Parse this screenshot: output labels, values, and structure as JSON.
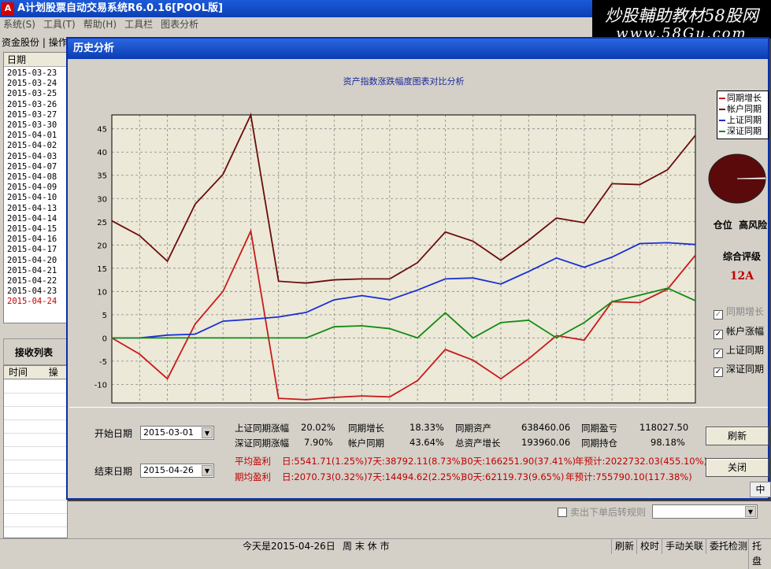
{
  "app": {
    "title": "A计划股票自动交易系统R6.0.16[POOL版]",
    "icon": "A"
  },
  "watermark": {
    "line1": "炒股輔助教材58股网",
    "line2": "www.58Gu.com"
  },
  "menu": [
    "系统(S)",
    "工具(T)",
    "帮助(H)",
    "工具栏",
    "图表分析"
  ],
  "tabs": [
    "资金股份",
    "操作"
  ],
  "left_list": {
    "header": "日期",
    "dates": [
      "2015-03-23",
      "2015-03-24",
      "2015-03-25",
      "2015-03-26",
      "2015-03-27",
      "2015-03-30",
      "2015-04-01",
      "2015-04-02",
      "2015-04-03",
      "2015-04-07",
      "2015-04-08",
      "2015-04-09",
      "2015-04-10",
      "2015-04-13",
      "2015-04-14",
      "2015-04-15",
      "2015-04-16",
      "2015-04-17",
      "2015-04-20",
      "2015-04-21",
      "2015-04-22",
      "2015-04-23",
      "2015-04-24"
    ],
    "selected_index": 22
  },
  "receive": {
    "title": "接收列表",
    "columns": [
      "时间",
      "操"
    ]
  },
  "dialog": {
    "title": "历史分析"
  },
  "chart_data": {
    "type": "line",
    "title": "资产指数涨跌幅度图表对比分析",
    "x": [
      0,
      1,
      2,
      3,
      4,
      5,
      6,
      7,
      8,
      9,
      10,
      11,
      12,
      13,
      14,
      15,
      16,
      17,
      18,
      19,
      20,
      21
    ],
    "xlim": [
      0,
      21
    ],
    "ylim": [
      -14,
      48
    ],
    "yticks": [
      -10,
      -5,
      0,
      5,
      10,
      15,
      20,
      25,
      30,
      35,
      40,
      45
    ],
    "grid": true,
    "legend": "top-right",
    "series": [
      {
        "name": "同期增长",
        "color": "#c81a1a",
        "values": [
          0,
          -3.5,
          -8.8,
          3,
          10,
          23,
          -13,
          -13.3,
          -12.8,
          -12.5,
          -12.7,
          -9.2,
          -2.5,
          -4.8,
          -8.8,
          -4.5,
          0.5,
          -0.5,
          7.8,
          7.6,
          10.5,
          17.8
        ]
      },
      {
        "name": "帐户同期",
        "color": "#6b0c0c",
        "values": [
          25.2,
          22,
          16.5,
          28.8,
          35.2,
          48,
          12.2,
          11.8,
          12.5,
          12.7,
          12.7,
          16.2,
          22.8,
          20.8,
          16.7,
          21,
          25.8,
          24.8,
          33.2,
          33,
          36.2,
          43.6
        ]
      },
      {
        "name": "上证同期",
        "color": "#1a2fd4",
        "values": [
          0,
          0,
          0.6,
          0.8,
          3.6,
          4,
          4.5,
          5.5,
          8.2,
          9.1,
          8.2,
          10.3,
          12.7,
          12.9,
          11.6,
          14.3,
          17.2,
          15.2,
          17.4,
          20.3,
          20.5,
          20.1
        ]
      },
      {
        "name": "深证同期",
        "color": "#128a12",
        "values": [
          0,
          0,
          0,
          0,
          0,
          0,
          0,
          0,
          2.4,
          2.6,
          2,
          0,
          5.4,
          0,
          3.3,
          3.8,
          0,
          3.3,
          7.8,
          9.2,
          10.7,
          8
        ]
      }
    ]
  },
  "right_panel": {
    "position_label": "仓位",
    "risk_label": "高风险",
    "rating_label": "综合评级",
    "grade": "12A",
    "pie_fill": 0.99
  },
  "checkboxes": [
    {
      "label": "同期增长",
      "checked": true,
      "disabled": true
    },
    {
      "label": "帐户涨幅",
      "checked": true,
      "disabled": false
    },
    {
      "label": "上证同期",
      "checked": true,
      "disabled": false
    },
    {
      "label": "深证同期",
      "checked": true,
      "disabled": false
    }
  ],
  "form": {
    "start_label": "开始日期",
    "start_value": "2015-03-01",
    "end_label": "结束日期",
    "end_value": "2015-04-26"
  },
  "stats": {
    "sh_label": "上证同期涨幅",
    "sh_value": "20.02%",
    "sz_label": "深证同期涨幅",
    "sz_value": "7.90%",
    "growth_label": "同期增长",
    "growth_value": "18.33%",
    "acct_label": "帐户同期",
    "acct_value": "43.64%",
    "asset_label": "同期资产",
    "asset_value": "638460.06",
    "total_label": "总资产增长",
    "total_value": "193960.06",
    "pnl_label": "同期盈亏",
    "pnl_value": "118027.50",
    "hold_label": "同期持仓",
    "hold_value": "98.18%",
    "avg_label": "平均盈利",
    "avg_day": "日:5541.71(1.25%)",
    "avg_7": "7天:38792.11(8.73%)",
    "avg_30": "30天:166251.90(37.41%)",
    "avg_year": "年预计:2022732.03(455.10%)",
    "per_label": "期均盈利",
    "per_day": "日:2070.73(0.32%)",
    "per_7": "7天:14494.62(2.25%)",
    "per_30": "30天:62119.73(9.65%)",
    "per_year": "年预计:755790.10(117.38%)"
  },
  "buttons": {
    "refresh": "刷新",
    "close": "关闭"
  },
  "bottom_right": {
    "checkbox_label": "卖出下单后转规则",
    "side": "中"
  },
  "status": {
    "today": "今天是2015-04-26日",
    "weekend": "周 末 休 市",
    "items": [
      "刷新",
      "校时",
      "手动关联",
      "委托检测",
      "托盘"
    ]
  }
}
